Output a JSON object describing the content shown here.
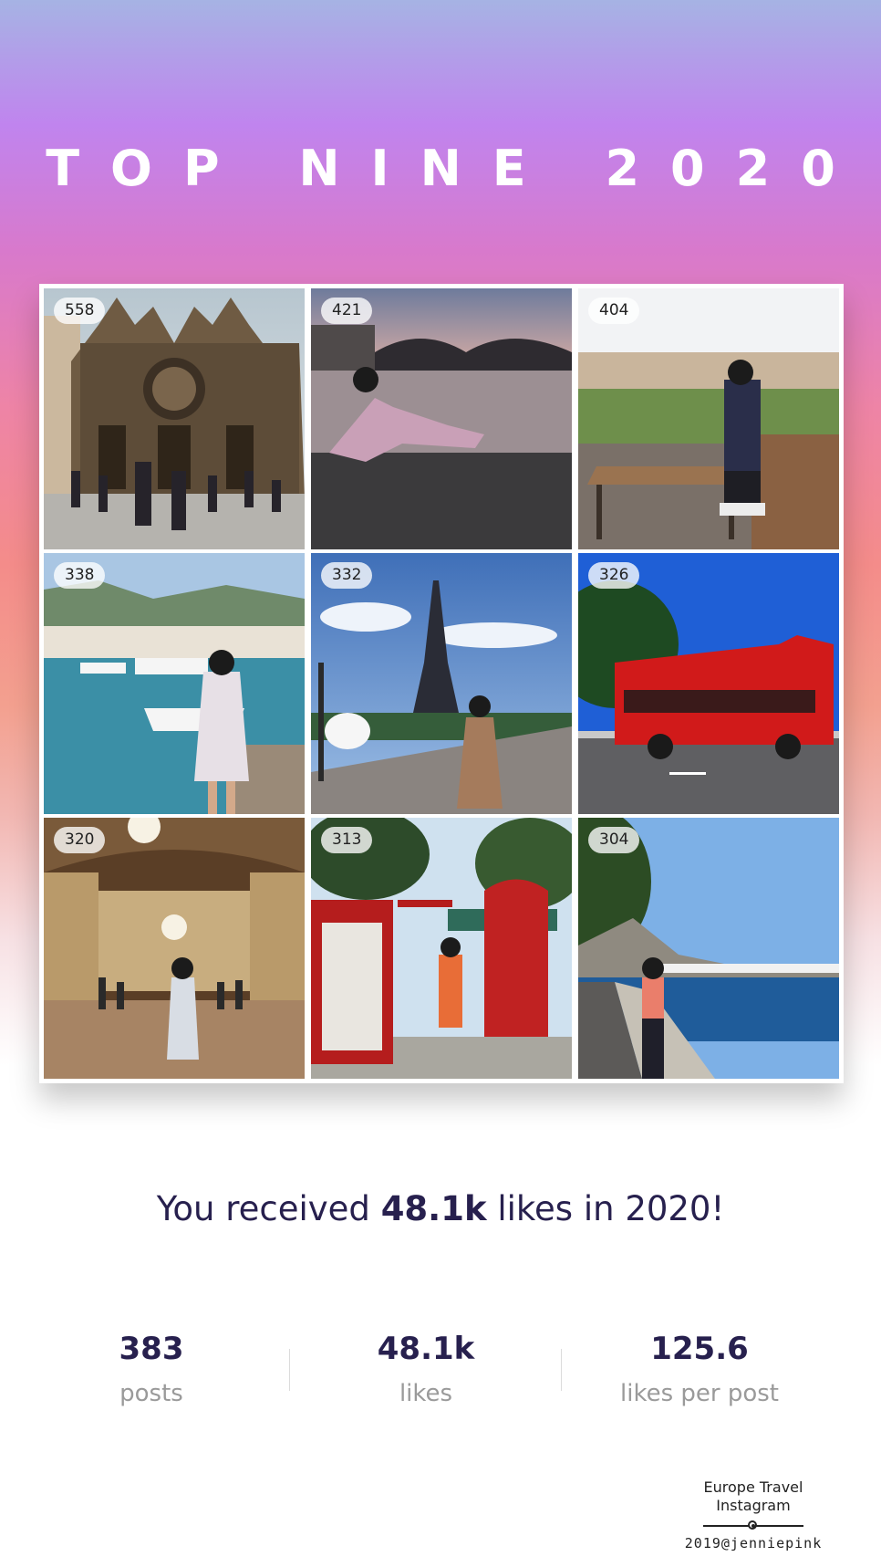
{
  "title": "TOP NINE 2020",
  "grid": [
    {
      "count": "558",
      "scene": "gothic-cathedral"
    },
    {
      "count": "421",
      "scene": "river-bridge-sunset"
    },
    {
      "count": "404",
      "scene": "cafe-terrace-city-view"
    },
    {
      "count": "338",
      "scene": "harbor-boats"
    },
    {
      "count": "332",
      "scene": "eiffel-tower"
    },
    {
      "count": "326",
      "scene": "red-tour-bus"
    },
    {
      "count": "320",
      "scene": "hall-of-mirrors"
    },
    {
      "count": "313",
      "scene": "red-post-booth"
    },
    {
      "count": "304",
      "scene": "seaside-promenade"
    }
  ],
  "summary": {
    "prefix": "You received ",
    "highlight": "48.1k",
    "suffix": " likes in 2020!"
  },
  "stats": [
    {
      "value": "383",
      "label": "posts"
    },
    {
      "value": "48.1k",
      "label": "likes"
    },
    {
      "value": "125.6",
      "label": "likes per post"
    }
  ],
  "signature": {
    "line1": "Europe Travel",
    "line2": "Instagram",
    "handle": "2019@jenniepink"
  },
  "colors": {
    "text_dark": "#27204e",
    "label_gray": "#9a9a9a"
  }
}
